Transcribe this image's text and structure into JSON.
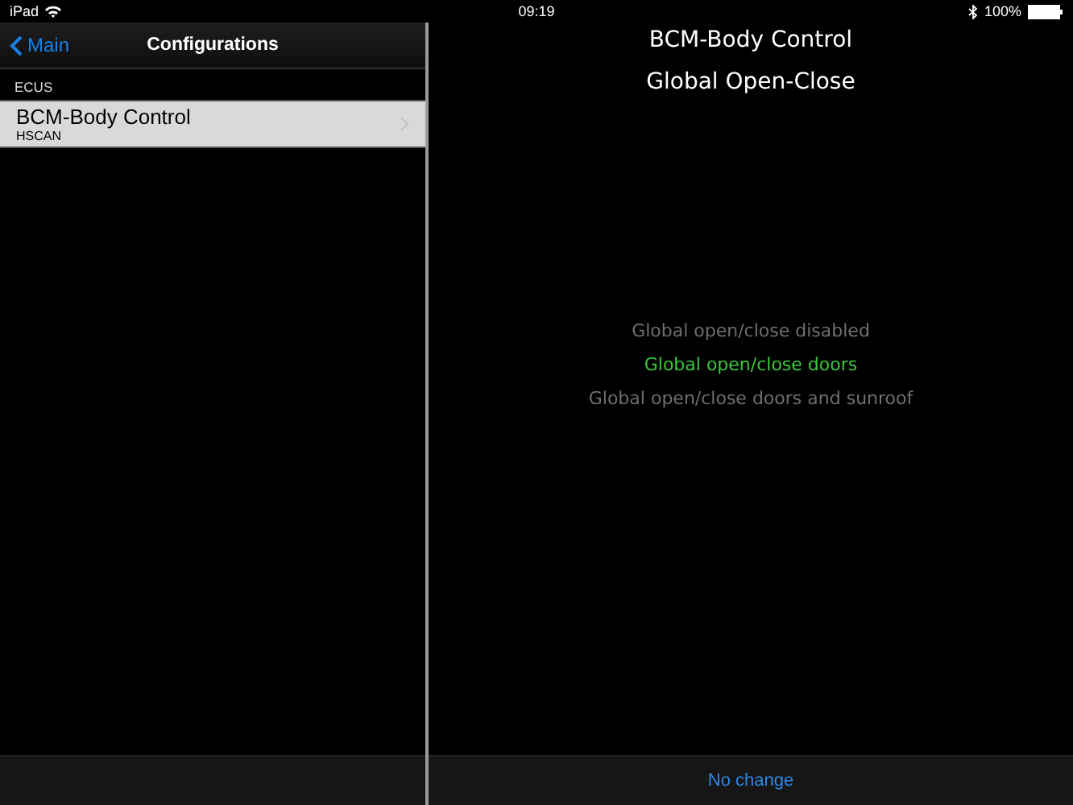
{
  "status_bar": {
    "device": "iPad",
    "time": "09:19",
    "battery": "100%"
  },
  "sidebar": {
    "back": "Main",
    "title": "Configurations",
    "section": "ECUS",
    "items": [
      {
        "name": "BCM-Body Control",
        "subtitle": "HSCAN",
        "selected": true
      }
    ]
  },
  "detail": {
    "title_lines": [
      "BCM-Body Control",
      "Global Open-Close"
    ],
    "options": [
      {
        "label": "Global open/close disabled",
        "selected": false
      },
      {
        "label": "Global open/close doors",
        "selected": true
      },
      {
        "label": "Global open/close doors and sunroof",
        "selected": false
      }
    ],
    "toolbar_button": "No change"
  }
}
